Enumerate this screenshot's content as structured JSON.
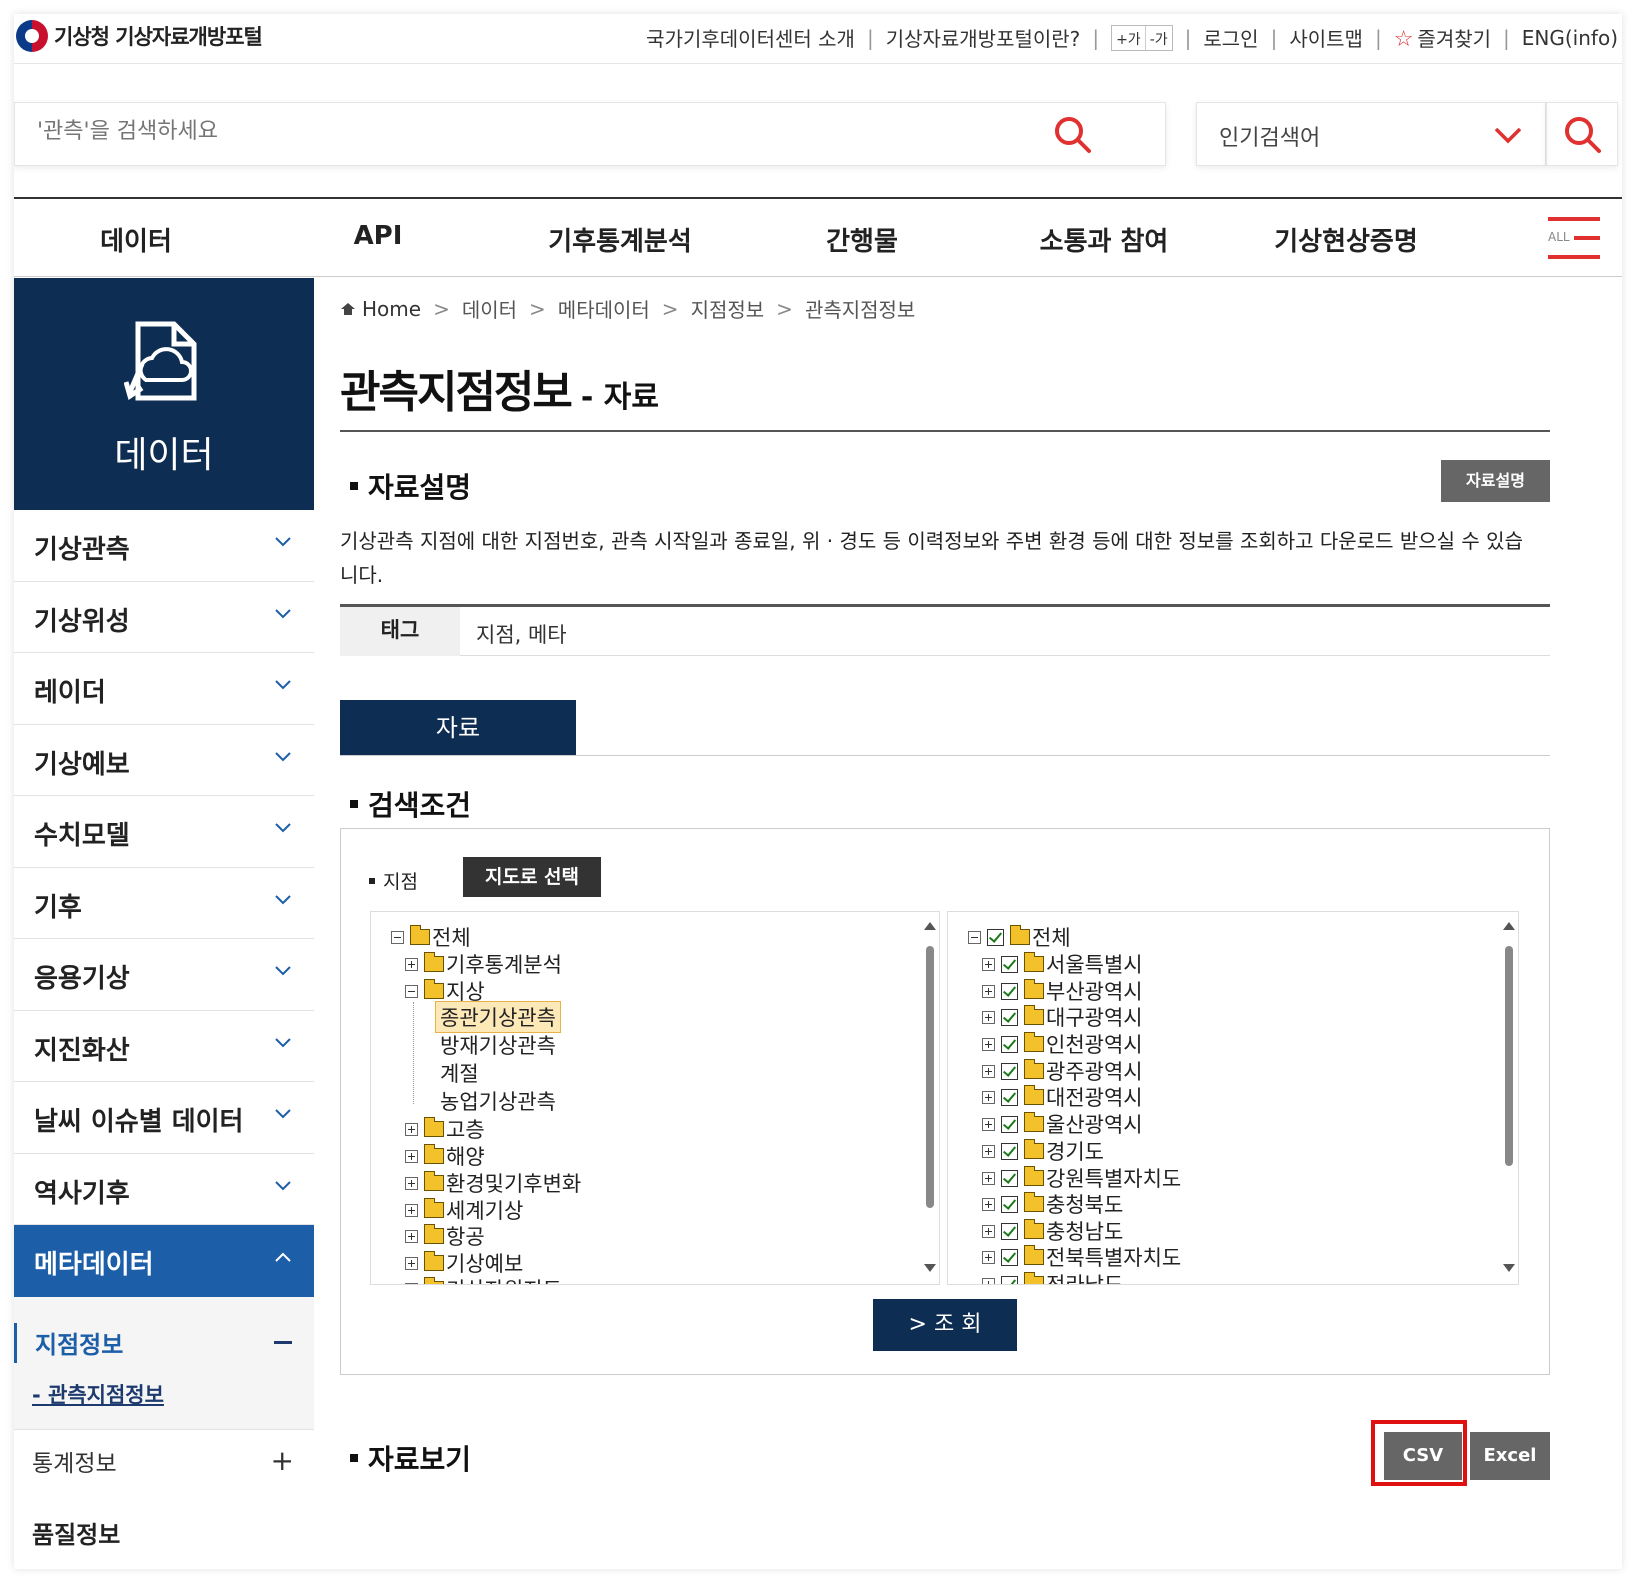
{
  "header": {
    "logo_text": "기상청 기상자료개방포털",
    "links": [
      "국가기후데이터센터 소개",
      "기상자료개방포털이란?"
    ],
    "font_plus": "+가",
    "font_minus": "-가",
    "login": "로그인",
    "sitemap": "사이트맵",
    "favorites": "즐겨찾기",
    "eng": "ENG(info)"
  },
  "search": {
    "placeholder": "'관측'을 검색하세요",
    "popular_label": "인기검색어"
  },
  "gnb": {
    "items": [
      "데이터",
      "API",
      "기후통계분석",
      "간행물",
      "소통과 참여",
      "기상현상증명"
    ],
    "all_label": "ALL"
  },
  "sidebar": {
    "hero_label": "데이터",
    "items": [
      "기상관측",
      "기상위성",
      "레이더",
      "기상예보",
      "수치모델",
      "기후",
      "응용기상",
      "지진화산",
      "날씨 이슈별 데이터",
      "역사기후"
    ],
    "active_item": "메타데이터",
    "sub_active": "지점정보",
    "sub_current": "- 관측지점정보",
    "sub_other": "통계정보",
    "sub_cut": "품질정보"
  },
  "breadcrumb": [
    "Home",
    "데이터",
    "메타데이터",
    "지점정보",
    "관측지점정보"
  ],
  "page": {
    "title": "관측지점정보",
    "subtitle": "- 자료"
  },
  "desc_section": {
    "heading": "자료설명",
    "button": "자료설명",
    "text": "기상관측 지점에 대한 지점번호, 관측 시작일과 종료일, 위 · 경도 등 이력정보와 주변 환경 등에 대한 정보를 조회하고 다운로드 받으실 수 있습니다.",
    "tag_label": "태그",
    "tag_value": "지점, 메타"
  },
  "tab": {
    "label": "자료"
  },
  "search_cond": {
    "heading": "검색조건",
    "station_label": "지점",
    "map_button": "지도로 선택",
    "left_tree": {
      "root": "전체",
      "nodes": [
        "기후통계분석",
        "지상",
        "고층",
        "해양",
        "환경및기후변화",
        "세계기상",
        "항공",
        "기상예보",
        "기상자원지도"
      ],
      "children": [
        "종관기상관측",
        "방재기상관측",
        "계절",
        "농업기상관측"
      ]
    },
    "right_tree": {
      "root": "전체",
      "nodes": [
        "서울특별시",
        "부산광역시",
        "대구광역시",
        "인천광역시",
        "광주광역시",
        "대전광역시",
        "울산광역시",
        "경기도",
        "강원특별자치도",
        "충청북도",
        "충청남도",
        "전북특별자치도",
        "전라남도"
      ]
    },
    "query_button": "> 조 회"
  },
  "view_section": {
    "heading": "자료보기",
    "csv": "CSV",
    "excel": "Excel"
  },
  "colors": {
    "navy": "#0e2d52",
    "active_blue": "#1d5ea8",
    "accent_red": "#e03030",
    "highlight_red": "#e01010"
  }
}
